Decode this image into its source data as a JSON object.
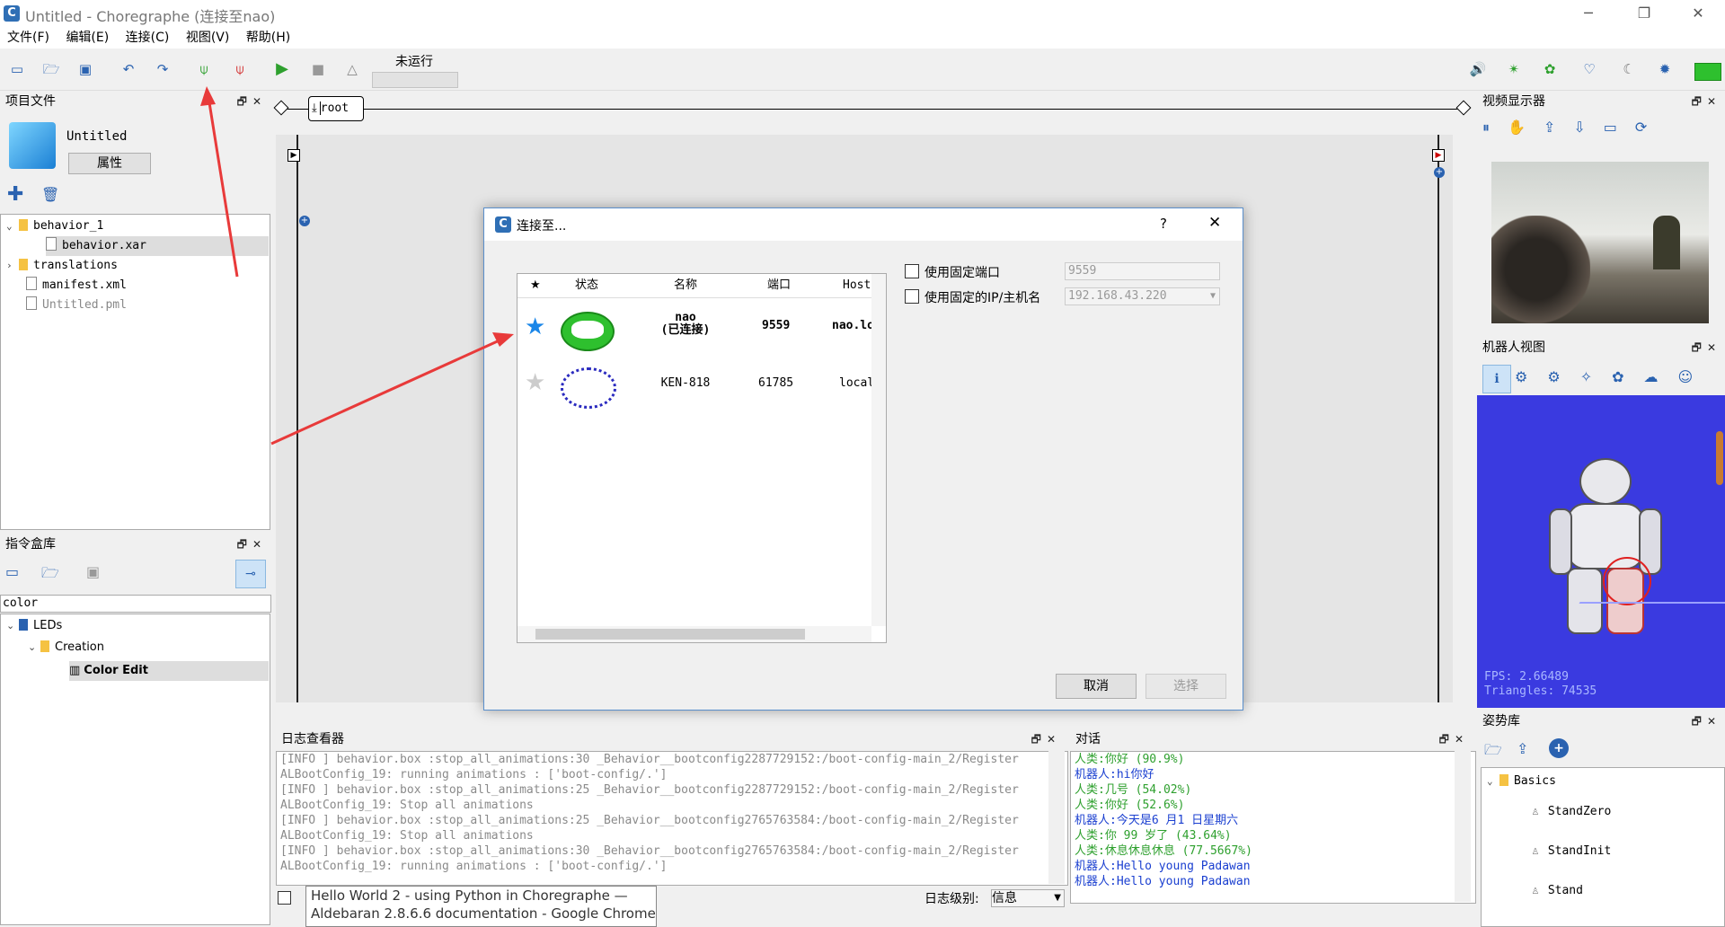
{
  "window": {
    "title": "Untitled - Choregraphe (连接至nao)",
    "app_icon": "C"
  },
  "menu": [
    "文件(F)",
    "编辑(E)",
    "连接(C)",
    "视图(V)",
    "帮助(H)"
  ],
  "toolbar": {
    "run_status": "未运行"
  },
  "project_panel": {
    "title": "项目文件",
    "project_name": "Untitled",
    "properties_button": "属性",
    "tree": [
      {
        "label": "behavior_1",
        "type": "folder",
        "expanded": true
      },
      {
        "label": "behavior.xar",
        "type": "file",
        "selected": true
      },
      {
        "label": "translations",
        "type": "folder",
        "expanded": false
      },
      {
        "label": "manifest.xml",
        "type": "file"
      },
      {
        "label": "Untitled.pml",
        "type": "file",
        "dim": true
      }
    ]
  },
  "box_library": {
    "title": "指令盒库",
    "filter_value": "color",
    "tree": [
      {
        "label": "LEDs"
      },
      {
        "label": "Creation"
      },
      {
        "label": "Color Edit"
      }
    ]
  },
  "canvas": {
    "breadcrumb": "root"
  },
  "dialog": {
    "title": "连接至...",
    "help": "?",
    "close": "✕",
    "columns": [
      "★",
      "状态",
      "名称",
      "端口",
      "Host"
    ],
    "rows": [
      {
        "name": "nao",
        "sub": "(已连接)",
        "port": "9559",
        "host": "nao.lo",
        "favorite": true,
        "status_color": "#2ec02e"
      },
      {
        "name": "KEN-818",
        "sub": "",
        "port": "61785",
        "host": "localh",
        "favorite": false,
        "status_color": "#2b2bbf"
      }
    ],
    "fixed_port_label": "使用固定端口",
    "fixed_port_value": "9559",
    "fixed_ip_label": "使用固定的IP/主机名",
    "fixed_ip_value": "192.168.43.220",
    "cancel": "取消",
    "select": "选择"
  },
  "video_panel": {
    "title": "视频显示器"
  },
  "robot_view": {
    "title": "机器人视图",
    "fps": "FPS: 2.66489",
    "triangles": "Triangles: 74535"
  },
  "pose_library": {
    "title": "姿势库",
    "folder": "Basics",
    "poses": [
      "StandZero",
      "StandInit",
      "Stand"
    ]
  },
  "log_viewer": {
    "title": "日志查看器",
    "lines": [
      "[INFO ] behavior.box :stop_all_animations:30 _Behavior__bootconfig2287729152:/boot-config-main_2/Register",
      "ALBootConfig_19: running animations : ['boot-config/.']",
      "[INFO ] behavior.box :stop_all_animations:25 _Behavior__bootconfig2287729152:/boot-config-main_2/Register",
      "ALBootConfig_19: Stop all animations",
      "[INFO ] behavior.box :stop_all_animations:25 _Behavior__bootconfig2765763584:/boot-config-main_2/Register",
      "ALBootConfig_19: Stop all animations",
      "[INFO ] behavior.box :stop_all_animations:30 _Behavior__bootconfig2765763584:/boot-config-main_2/Register",
      "ALBootConfig_19: running animations : ['boot-config/.']"
    ],
    "level_label": "日志级别:",
    "level_value": "信息"
  },
  "dialog_panel": {
    "title": "对话",
    "lines": [
      {
        "speaker": "人类:",
        "text": "你好 (90.9%)",
        "robot": false
      },
      {
        "speaker": "机器人:",
        "text": "hi你好",
        "robot": true
      },
      {
        "speaker": "人类:",
        "text": "几号 (54.02%)",
        "robot": false
      },
      {
        "speaker": "人类:",
        "text": "你好 (52.6%)",
        "robot": false
      },
      {
        "speaker": "机器人:",
        "text": "今天是6 月1 日星期六",
        "robot": true
      },
      {
        "speaker": "人类:",
        "text": "你 99 岁了 (43.64%)",
        "robot": false
      },
      {
        "speaker": "人类:",
        "text": "休息休息休息 (77.5667%)",
        "robot": false
      },
      {
        "speaker": "机器人:",
        "text": "Hello young Padawan",
        "robot": true
      },
      {
        "speaker": "机器人:",
        "text": "Hello young Padawan",
        "robot": true
      }
    ]
  },
  "tooltip": {
    "line1": "Hello World 2 - using Python in Choregraphe —",
    "line2": "Aldebaran 2.8.6.6 documentation - Google Chrome"
  },
  "colors": {
    "accent": "#2a62b0",
    "annotation": "#e83a3a",
    "robot_bg": "#3a3ae0"
  }
}
